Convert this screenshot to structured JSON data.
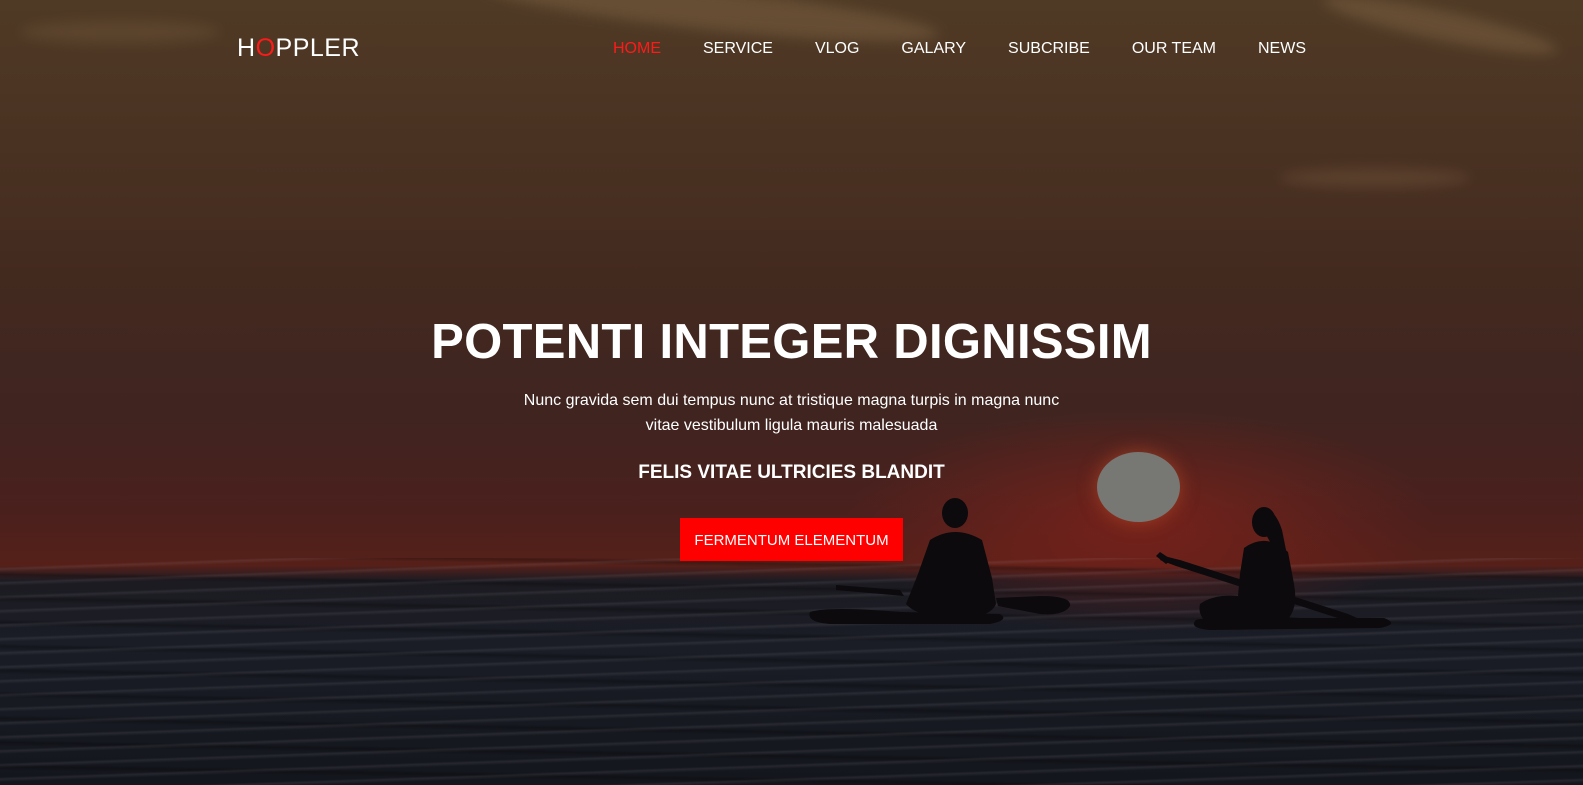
{
  "logo": {
    "part1": "H",
    "accent": "O",
    "part2": "PPLER"
  },
  "nav": {
    "items": [
      {
        "label": "HOME",
        "active": true
      },
      {
        "label": "SERVICE"
      },
      {
        "label": "VLOG"
      },
      {
        "label": "GALARY"
      },
      {
        "label": "SUBCRIBE"
      },
      {
        "label": "OUR TEAM"
      },
      {
        "label": "NEWS"
      }
    ]
  },
  "hero": {
    "headline": "POTENTI INTEGER DIGNISSIM",
    "lead": "Nunc gravida sem dui tempus nunc at tristique magna turpis in magna nunc vitae vestibulum ligula mauris malesuada",
    "tagline": "FELIS VITAE ULTRICIES BLANDIT",
    "cta_label": "FERMENTUM ELEMENTUM"
  },
  "colors": {
    "accent": "#ff0000",
    "text": "#ffffff"
  }
}
